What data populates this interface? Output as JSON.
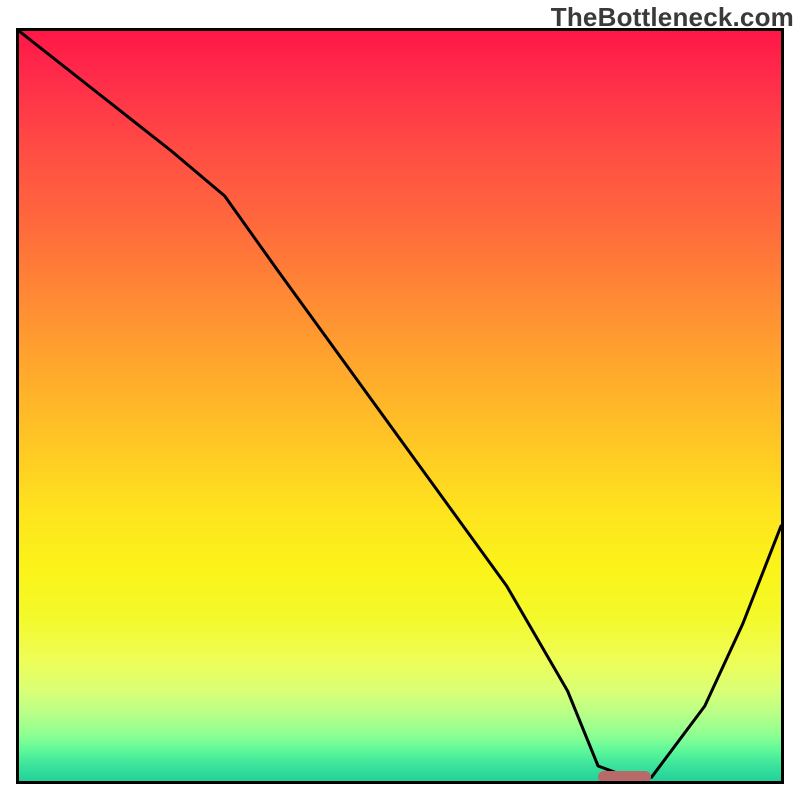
{
  "watermark": "TheBottleneck.com",
  "chart_data": {
    "type": "line",
    "title": "",
    "xlabel": "",
    "ylabel": "",
    "xlim": [
      0,
      100
    ],
    "ylim": [
      0,
      100
    ],
    "grid": false,
    "legend": false,
    "marker": {
      "x_start": 76,
      "x_end": 83,
      "y": 0.5,
      "color": "#b76a67"
    },
    "series": [
      {
        "name": "bottleneck-curve",
        "x": [
          0,
          10,
          20,
          27,
          34,
          44,
          54,
          64,
          72,
          76,
          80,
          83,
          90,
          95,
          100
        ],
        "y": [
          100,
          92,
          84,
          78,
          68,
          54,
          40,
          26,
          12,
          2,
          0.5,
          0.5,
          10,
          21,
          34
        ]
      }
    ]
  },
  "frame": {
    "inner_w": 762,
    "inner_h": 750
  }
}
